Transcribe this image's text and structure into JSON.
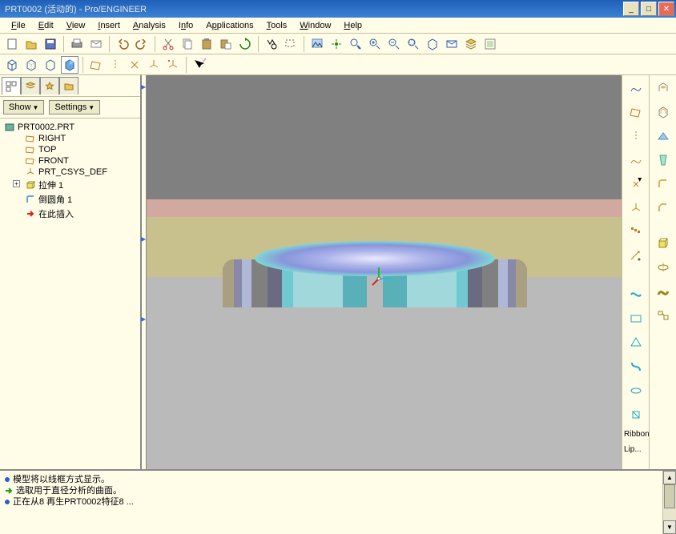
{
  "app": {
    "title": "PRT0002 (活动的) - Pro/ENGINEER"
  },
  "menu": [
    "File",
    "Edit",
    "View",
    "Insert",
    "Analysis",
    "Info",
    "Applications",
    "Tools",
    "Window",
    "Help"
  ],
  "panel": {
    "show_btn": "Show",
    "settings_btn": "Settings"
  },
  "tree": {
    "root": "PRT0002.PRT",
    "items": [
      {
        "icon": "datum-plane",
        "label": "RIGHT"
      },
      {
        "icon": "datum-plane",
        "label": "TOP"
      },
      {
        "icon": "datum-plane",
        "label": "FRONT"
      },
      {
        "icon": "csys",
        "label": "PRT_CSYS_DEF"
      },
      {
        "icon": "extrude",
        "label": "拉伸 1",
        "expandable": true
      },
      {
        "icon": "round",
        "label": "倒圆角 1"
      },
      {
        "icon": "insert",
        "label": "在此插入"
      }
    ]
  },
  "right_labels": {
    "ribbon": "Ribbon...",
    "lip": "Lip..."
  },
  "status": [
    {
      "color": "#2d5bd0",
      "text": "模型将以线框方式显示。"
    },
    {
      "color": "#1d9a1d",
      "arrow": true,
      "text": "选取用于直径分析的曲面。"
    },
    {
      "color": "#2d5bd0",
      "text": "正在从8 再生PRT0002特征8 ..."
    }
  ]
}
